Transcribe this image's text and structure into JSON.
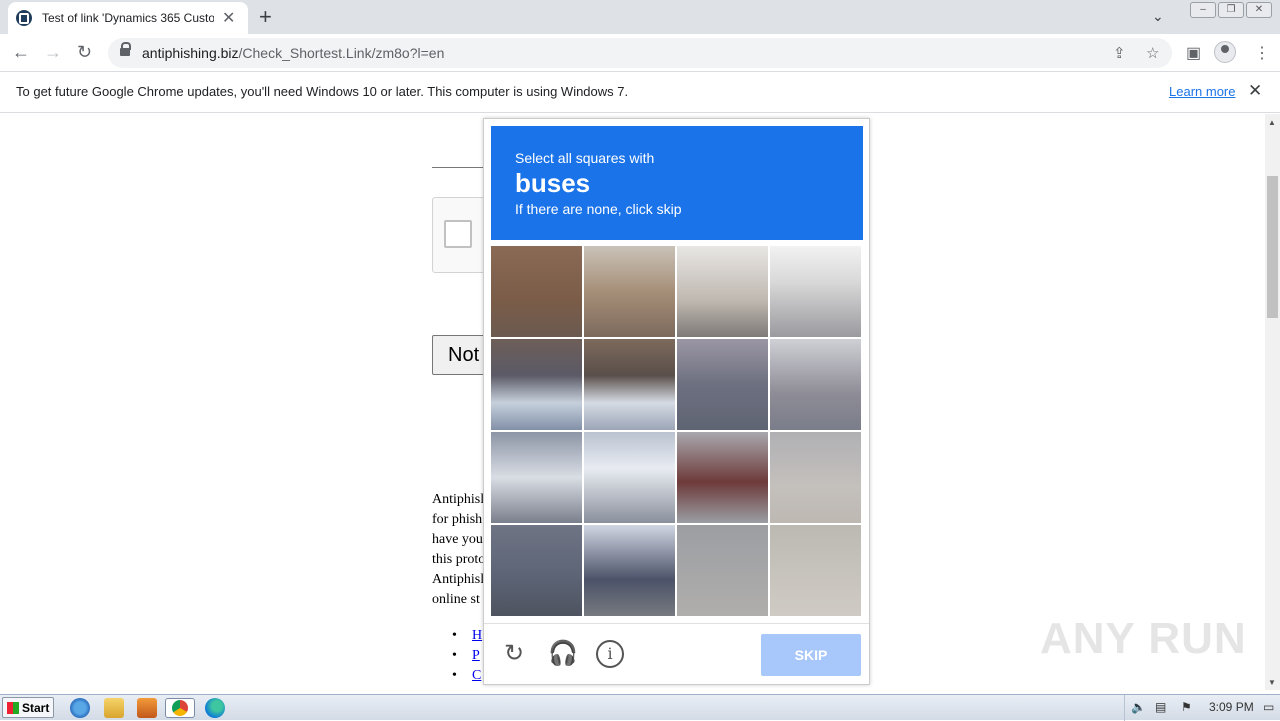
{
  "browser": {
    "tab_title": "Test of link 'Dynamics 365 Customer",
    "tab_close": "✕",
    "new_tab": "+",
    "url_domain": "antiphishing.biz",
    "url_path": "/Check_Shortest.Link/zm8o?l=en"
  },
  "infobar": {
    "message": "To get future Google Chrome updates, you'll need Windows 10 or later. This computer is using Windows 7.",
    "learn_more": "Learn more",
    "close": "✕"
  },
  "page": {
    "button_label": "Not",
    "paragraph_lines": [
      "Antiphisl",
      "for phish",
      "have you",
      "this proto",
      "Antiphisl",
      "online st"
    ],
    "links": [
      "H",
      "P",
      "C"
    ]
  },
  "captcha": {
    "instruction": "Select all squares with",
    "target": "buses",
    "hint": "If there are none, click skip",
    "skip_label": "SKIP",
    "reload_icon": "reload-icon",
    "audio_icon": "headphones-icon",
    "info_icon": "info-icon"
  },
  "watermark": "ANY RUN",
  "taskbar": {
    "start_label": "Start",
    "clock": "3:09 PM"
  }
}
